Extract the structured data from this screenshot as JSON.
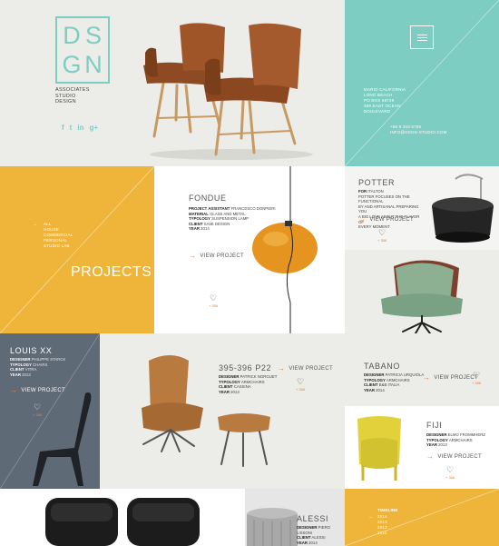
{
  "brand": {
    "logo_letters": [
      "D",
      "S",
      "G",
      "N"
    ],
    "tagline": [
      "ASSOCIATES",
      "STUDIO",
      "DESIGN"
    ],
    "social_icons": [
      "f",
      "t",
      "in",
      "g+"
    ],
    "accent": "#7ecdc3"
  },
  "contact": {
    "address": [
      "MARIO CALIFORNIA",
      "LONG BEACH",
      "PO BOX 68749",
      "369 EAST OCEAN",
      "BOULEVARD"
    ],
    "phone": "+56 8 343 6756",
    "email": "INFO@DSGN-STUDIO.COM"
  },
  "projects_panel": {
    "filters": [
      "ALL",
      "HOUSE",
      "COMMERCIAL",
      "PERSONAL",
      "STUDIO LAB"
    ],
    "heading": "PROJECTS"
  },
  "fondue": {
    "title": "FONDUE",
    "meta": [
      {
        "k": "PROJECT ASSISTANT",
        "v": "FRANCESCO DONPIERI"
      },
      {
        "k": "MATERIAL",
        "v": "GLASS AND METAL"
      },
      {
        "k": "TYPOLOGY",
        "v": "SUSPENSION LAMP"
      },
      {
        "k": "CLIENT",
        "v": "SA5E DESIGN"
      },
      {
        "k": "YEAR",
        "v": "2014"
      }
    ],
    "cta": "VIEW PROJECT",
    "likes": "+ 356"
  },
  "potter": {
    "title": "POTTER",
    "meta": [
      {
        "k": "FOR",
        "v": "ITALTON"
      },
      {
        "k": "",
        "v": "POTTER FOCUSES ON THE FUNCTIONAL"
      },
      {
        "k": "",
        "v": "BY AND ARTISANAL PREPARING YOU"
      },
      {
        "k": "",
        "v": "A BIG LOVE ABOUT THE FLAVOR OF"
      },
      {
        "k": "",
        "v": "EVERY MOMENT"
      }
    ],
    "cta": "VIEW PROJECT",
    "likes": "+ 356"
  },
  "louis": {
    "title": "LOUIS XX",
    "meta": [
      {
        "k": "DESIGNER",
        "v": "PHILIPPE STARCK"
      },
      {
        "k": "TYPOLOGY",
        "v": "CHAIRS"
      },
      {
        "k": "CLIENT",
        "v": "VITRA"
      },
      {
        "k": "YEAR",
        "v": "2013"
      }
    ],
    "cta": "VIEW PROJECT",
    "likes": "+ 356"
  },
  "p22": {
    "title": "395-396 P22",
    "meta": [
      {
        "k": "DESIGNER",
        "v": "PATRICK NORGUET"
      },
      {
        "k": "TYPOLOGY",
        "v": "ARMCHAIRS"
      },
      {
        "k": "CLIENT",
        "v": "CASSINA"
      },
      {
        "k": "YEAR",
        "v": "2013"
      }
    ],
    "cta": "VIEW PROJECT",
    "likes": "+ 356"
  },
  "tabano": {
    "title": "TABANO",
    "meta": [
      {
        "k": "DESIGNER",
        "v": "PATRICIA URQUIOLA"
      },
      {
        "k": "TYPOLOGY",
        "v": "ARMCHAIRS"
      },
      {
        "k": "CLIENT",
        "v": "B&B ITALIA"
      },
      {
        "k": "YEAR",
        "v": "2014"
      }
    ],
    "cta": "VIEW PROJECT",
    "likes": "+ 356"
  },
  "fiji": {
    "title": "FIJI",
    "meta": [
      {
        "k": "DESIGNER",
        "v": "ELMO FROMMHERZ"
      },
      {
        "k": "TYPOLOGY",
        "v": "ARMCHAIRS"
      },
      {
        "k": "YEAR",
        "v": "2013"
      }
    ],
    "cta": "VIEW PROJECT",
    "likes": "+ 356"
  },
  "alessi": {
    "title": "ALESSI",
    "meta": [
      {
        "k": "DESIGNER",
        "v": "PIERO LISSONI"
      },
      {
        "k": "CLIENT",
        "v": "ALESSI"
      },
      {
        "k": "YEAR",
        "v": "2014"
      }
    ]
  },
  "timeline": {
    "title": "TIMELINE",
    "years": [
      "2014",
      "2013",
      "2012",
      "2011"
    ]
  },
  "colors": {
    "teal": "#7ecdc3",
    "yellow": "#eeb53a",
    "slate": "#5f6a77",
    "light": "#ecece8",
    "orange": "#e8803a"
  }
}
